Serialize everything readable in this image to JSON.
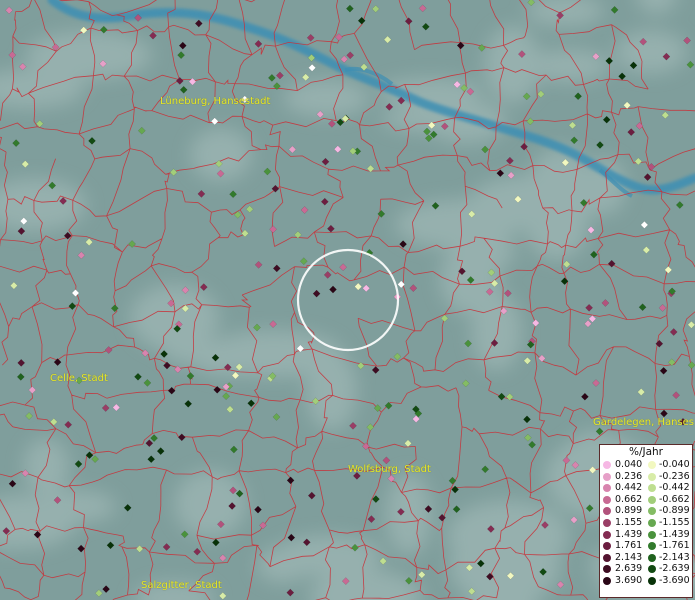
{
  "map": {
    "labels": [
      {
        "id": "lueneburg",
        "text": "Lüneburg, Hansestadt"
      },
      {
        "id": "celle",
        "text": "Celle, Stadt"
      },
      {
        "id": "gardelegen",
        "text": "Gardelegen, Hanses"
      },
      {
        "id": "wolfsburg",
        "text": "Wolfsburg, Stadt"
      },
      {
        "id": "salzgitter",
        "text": "Salzgitter, Stadt"
      }
    ],
    "colors": {
      "background": "#7f9e9c",
      "cloud": "#a9c0bd",
      "river": "#3d8fb4",
      "borders": "#c8323a",
      "label": "#e8e82a",
      "circle": "#ffffff"
    }
  },
  "legend": {
    "title": "%/Jahr",
    "positive": [
      {
        "value": "0.040",
        "color": "#f6b8e4"
      },
      {
        "value": "0.236",
        "color": "#e6a0c8"
      },
      {
        "value": "0.442",
        "color": "#d884ae"
      },
      {
        "value": "0.662",
        "color": "#c86a94"
      },
      {
        "value": "0.899",
        "color": "#b2527c"
      },
      {
        "value": "1.155",
        "color": "#9a3e66"
      },
      {
        "value": "1.439",
        "color": "#842c52"
      },
      {
        "value": "1.761",
        "color": "#6c1e40"
      },
      {
        "value": "2.143",
        "color": "#541430"
      },
      {
        "value": "2.639",
        "color": "#3e0c22"
      },
      {
        "value": "3.690",
        "color": "#2a0616"
      }
    ],
    "negative": [
      {
        "value": "-0.040",
        "color": "#f2f8c0"
      },
      {
        "value": "-0.236",
        "color": "#d8eca8"
      },
      {
        "value": "-0.442",
        "color": "#bede90"
      },
      {
        "value": "-0.662",
        "color": "#a2ce7a"
      },
      {
        "value": "-0.899",
        "color": "#84bc64"
      },
      {
        "value": "-1.155",
        "color": "#66a850"
      },
      {
        "value": "-1.439",
        "color": "#4a923c"
      },
      {
        "value": "-1.761",
        "color": "#327a2c"
      },
      {
        "value": "-2.143",
        "color": "#20621e"
      },
      {
        "value": "-2.639",
        "color": "#124a12"
      },
      {
        "value": "-3.690",
        "color": "#083208"
      }
    ]
  }
}
